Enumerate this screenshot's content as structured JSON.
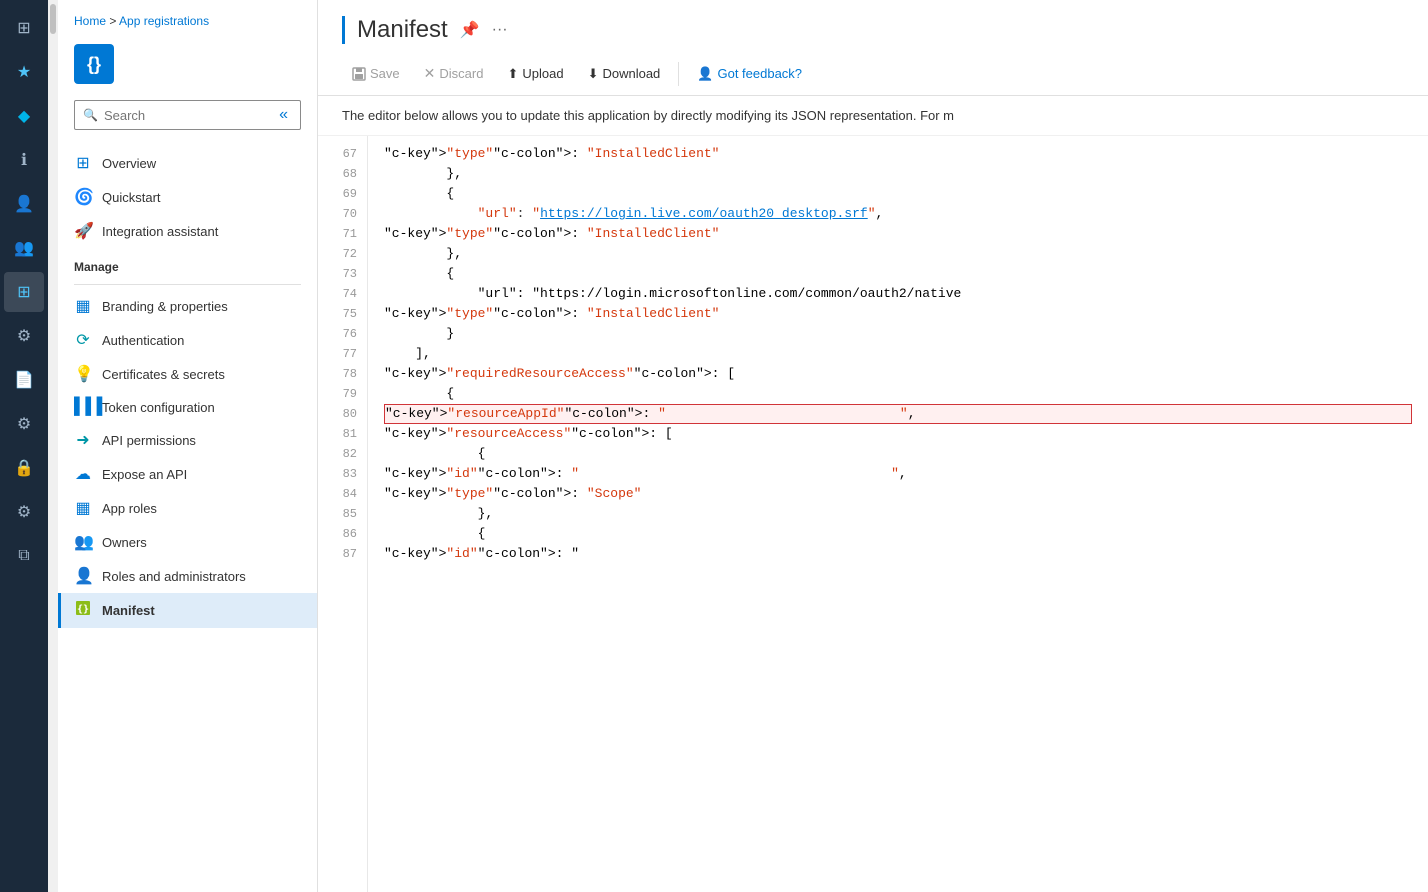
{
  "iconBar": {
    "items": [
      {
        "name": "home-icon",
        "icon": "⊞",
        "active": false
      },
      {
        "name": "favorites-icon",
        "icon": "★",
        "active": false,
        "highlighted": true
      },
      {
        "name": "azure-icon",
        "icon": "◆",
        "active": false,
        "highlighted": true
      },
      {
        "name": "info-icon",
        "icon": "ℹ",
        "active": false
      },
      {
        "name": "users-icon",
        "icon": "👤",
        "active": false
      },
      {
        "name": "groups-icon",
        "icon": "👥",
        "active": false
      },
      {
        "name": "enterprise-icon",
        "icon": "⊞",
        "active": true,
        "highlighted": true
      },
      {
        "name": "managed-icon",
        "icon": "⚙",
        "active": false
      },
      {
        "name": "documents-icon",
        "icon": "📄",
        "active": false
      },
      {
        "name": "settings-icon",
        "icon": "⚙",
        "active": false
      },
      {
        "name": "lock-icon",
        "icon": "🔒",
        "active": false
      },
      {
        "name": "config-icon",
        "icon": "⚙",
        "active": false
      },
      {
        "name": "copy-icon",
        "icon": "⧉",
        "active": false
      }
    ]
  },
  "breadcrumb": {
    "home": "Home",
    "separator": " > ",
    "current": "App registrations"
  },
  "appIcon": {
    "symbol": "{}"
  },
  "search": {
    "placeholder": "Search",
    "value": ""
  },
  "nav": {
    "items": [
      {
        "name": "overview",
        "label": "Overview",
        "icon": "⊞",
        "iconClass": "blue",
        "active": false
      },
      {
        "name": "quickstart",
        "label": "Quickstart",
        "icon": "🌀",
        "iconClass": "teal",
        "active": false
      },
      {
        "name": "integration-assistant",
        "label": "Integration assistant",
        "icon": "🚀",
        "iconClass": "orange",
        "active": false
      }
    ],
    "manageLabel": "Manage",
    "manageItems": [
      {
        "name": "branding-properties",
        "label": "Branding & properties",
        "icon": "▦",
        "iconClass": "blue",
        "active": false
      },
      {
        "name": "authentication",
        "label": "Authentication",
        "icon": "⟳",
        "iconClass": "cyan",
        "active": false
      },
      {
        "name": "certificates-secrets",
        "label": "Certificates & secrets",
        "icon": "💡",
        "iconClass": "yellow",
        "active": false
      },
      {
        "name": "token-configuration",
        "label": "Token configuration",
        "icon": "▌▌▌",
        "iconClass": "blue",
        "active": false
      },
      {
        "name": "api-permissions",
        "label": "API permissions",
        "icon": "➜",
        "iconClass": "cyan",
        "active": false
      },
      {
        "name": "expose-api",
        "label": "Expose an API",
        "icon": "☁",
        "iconClass": "blue",
        "active": false
      },
      {
        "name": "app-roles",
        "label": "App roles",
        "icon": "▦",
        "iconClass": "blue",
        "active": false
      },
      {
        "name": "owners",
        "label": "Owners",
        "icon": "👥",
        "iconClass": "blue",
        "active": false
      },
      {
        "name": "roles-administrators",
        "label": "Roles and administrators",
        "icon": "👤",
        "iconClass": "green",
        "active": false
      },
      {
        "name": "manifest",
        "label": "Manifest",
        "icon": "▦",
        "iconClass": "lime",
        "active": true
      }
    ]
  },
  "page": {
    "title": "Manifest",
    "description": "The editor below allows you to update this application by directly modifying its JSON representation. For m"
  },
  "toolbar": {
    "save_label": "Save",
    "discard_label": "Discard",
    "upload_label": "Upload",
    "download_label": "Download",
    "feedback_label": "Got feedback?"
  },
  "codeLines": [
    {
      "num": 67,
      "content": "            \"type\": \"InstalledClient\"",
      "highlight": false
    },
    {
      "num": 68,
      "content": "        },",
      "highlight": false
    },
    {
      "num": 69,
      "content": "        {",
      "highlight": false
    },
    {
      "num": 70,
      "content": "            \"url\": \"https://login.live.com/oauth20_desktop.srf\",",
      "highlight": false,
      "hasUrl": true,
      "url": "https://login.live.com/oauth20_desktop.srf"
    },
    {
      "num": 71,
      "content": "            \"type\": \"InstalledClient\"",
      "highlight": false
    },
    {
      "num": 72,
      "content": "        },",
      "highlight": false
    },
    {
      "num": 73,
      "content": "        {",
      "highlight": false
    },
    {
      "num": 74,
      "content": "            \"url\": \"https://login.microsoftonline.com/common/oauth2/native",
      "highlight": false,
      "hasUrl": true,
      "url": "https://login.microsoftonline.com/common/oauth2/native"
    },
    {
      "num": 75,
      "content": "            \"type\": \"InstalledClient\"",
      "highlight": false
    },
    {
      "num": 76,
      "content": "        }",
      "highlight": false
    },
    {
      "num": 77,
      "content": "    ],",
      "highlight": false
    },
    {
      "num": 78,
      "content": "    \"requiredResourceAccess\": [",
      "highlight": false
    },
    {
      "num": 79,
      "content": "        {",
      "highlight": false
    },
    {
      "num": 80,
      "content": "            \"resourceAppId\": \"                              \",",
      "highlight": true
    },
    {
      "num": 81,
      "content": "            \"resourceAccess\": [",
      "highlight": false
    },
    {
      "num": 82,
      "content": "            {",
      "highlight": false
    },
    {
      "num": 83,
      "content": "                    \"id\": \"                                        \",",
      "highlight": false
    },
    {
      "num": 84,
      "content": "                    \"type\": \"Scope\"",
      "highlight": false
    },
    {
      "num": 85,
      "content": "            },",
      "highlight": false
    },
    {
      "num": 86,
      "content": "            {",
      "highlight": false
    },
    {
      "num": 87,
      "content": "                    \"id\": \"",
      "highlight": false
    }
  ]
}
